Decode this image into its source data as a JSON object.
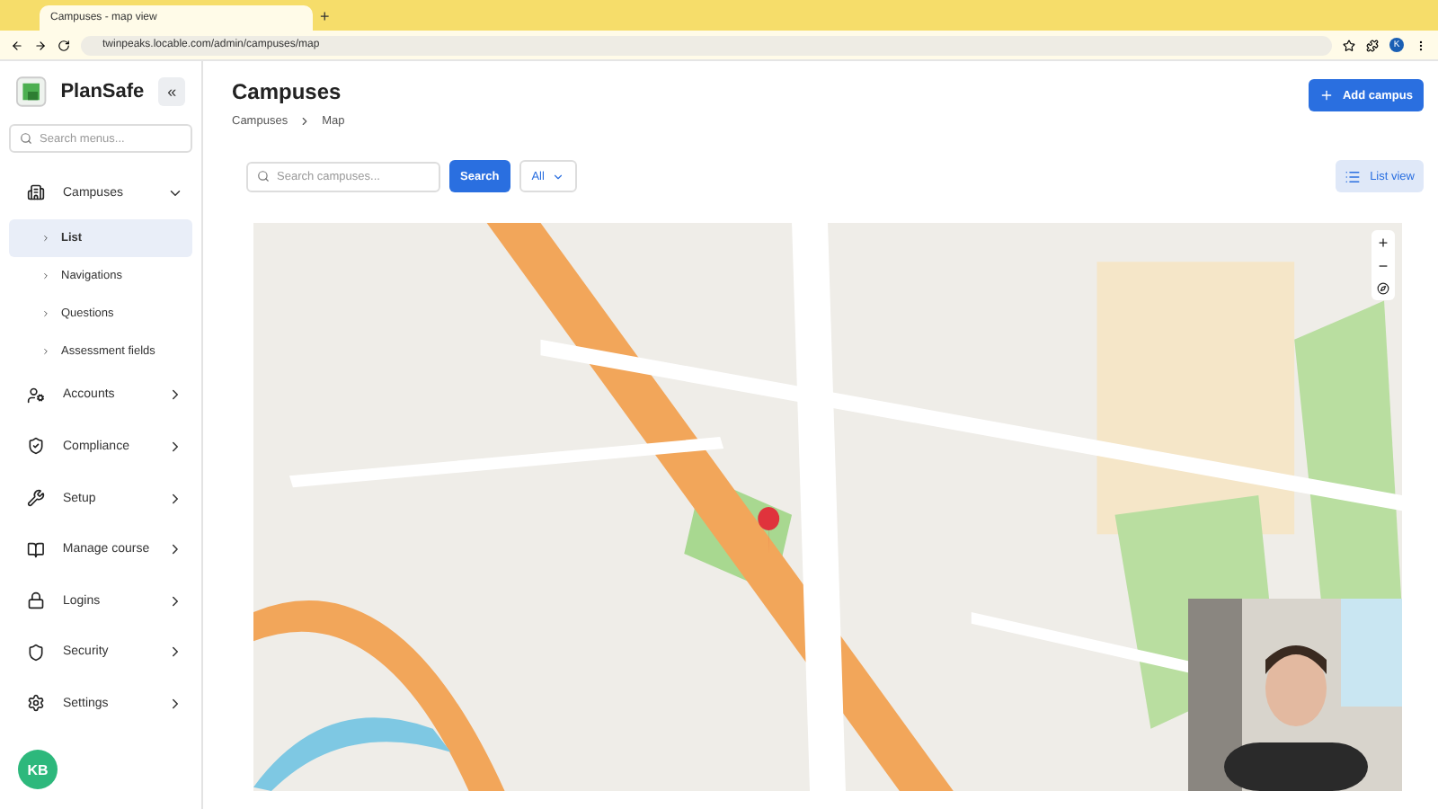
{
  "browser": {
    "tab_title": "Campuses - map view",
    "new_tab": "+",
    "url": "twinpeaks.locable.com/admin/campuses/map",
    "profile": "K"
  },
  "sidebar": {
    "app_name": "PlanSafe",
    "collapse": "«",
    "search": {
      "placeholder": "Search menus..."
    },
    "items": [
      {
        "label": "Campuses",
        "expanded": true,
        "children": [
          {
            "label": "List",
            "selected": true
          },
          {
            "label": "Navigations",
            "selected": false
          },
          {
            "label": "Questions",
            "selected": false
          },
          {
            "label": "Assessment fields",
            "selected": false
          }
        ]
      },
      {
        "label": "Accounts",
        "expanded": false
      },
      {
        "label": "Compliance",
        "expanded": false
      },
      {
        "label": "Setup",
        "expanded": false
      },
      {
        "label": "Manage course",
        "expanded": false
      },
      {
        "label": "Logins",
        "expanded": false
      },
      {
        "label": "Security",
        "expanded": false
      },
      {
        "label": "Settings",
        "expanded": false
      }
    ],
    "avatar": "KB"
  },
  "page": {
    "title": "Campuses",
    "breadcrumbs": [
      "Campuses",
      "Map"
    ],
    "add_button": "Add campus"
  },
  "toolbar": {
    "search": {
      "placeholder": "Search campuses..."
    },
    "search_button": "Search",
    "filter": "All",
    "view_button": "List view"
  },
  "map": {
    "kind": "picture",
    "zoom_in": "+",
    "zoom_out": "−"
  }
}
